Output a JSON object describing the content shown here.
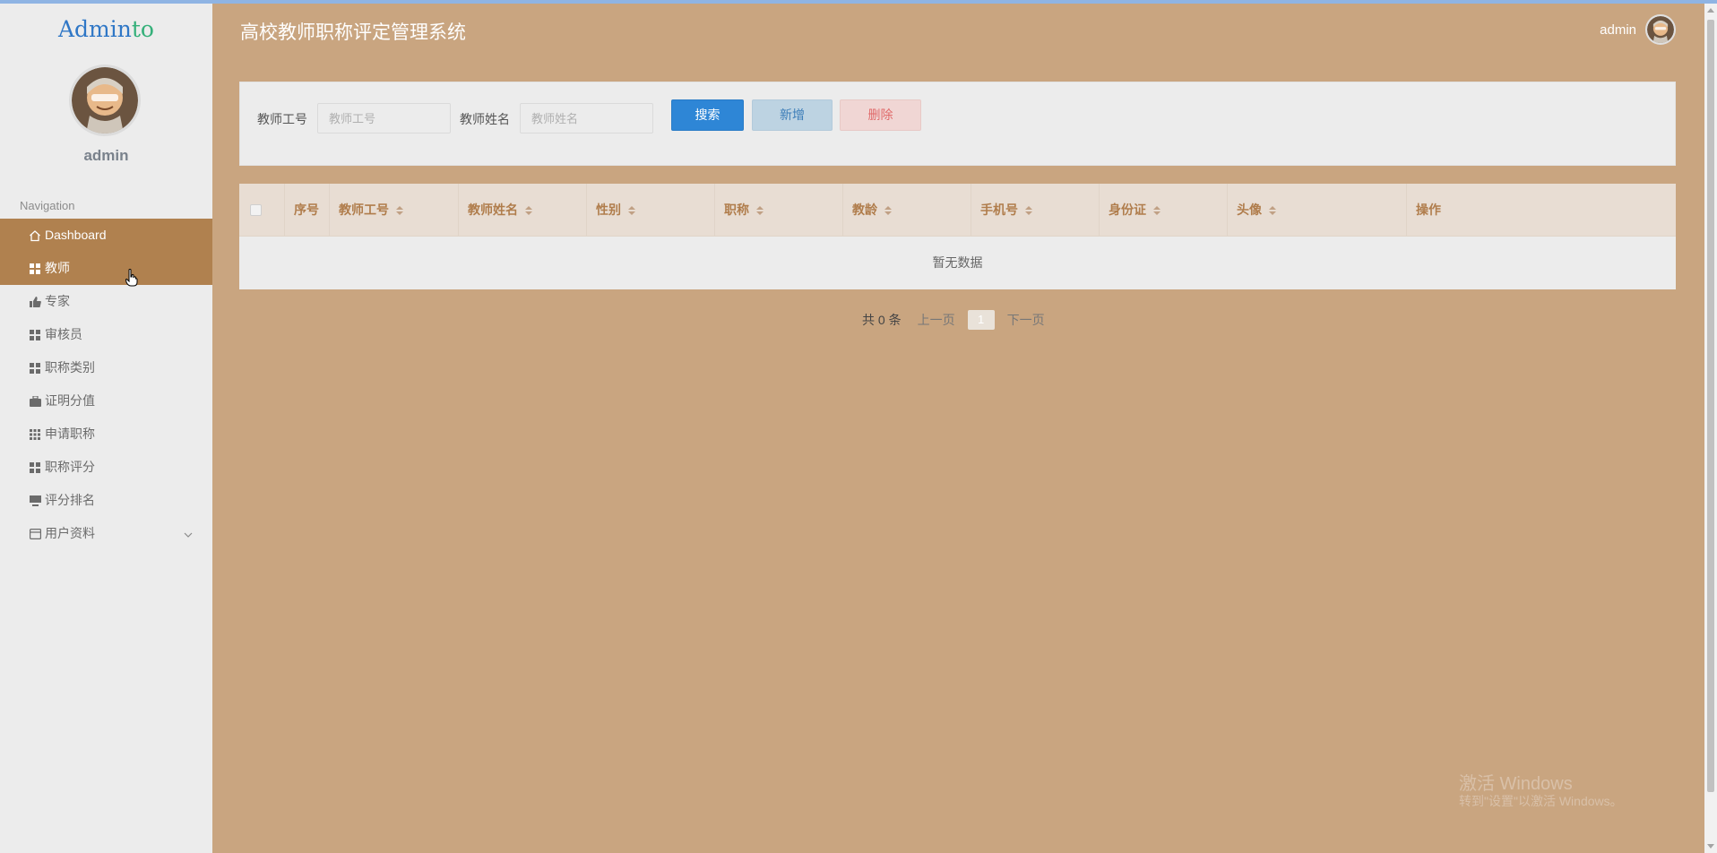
{
  "sidebar": {
    "logo_main": "Admin",
    "logo_accent": "to",
    "user_name": "admin",
    "nav_heading": "Navigation",
    "items": [
      {
        "label": "Dashboard",
        "icon": "home-icon",
        "active": true
      },
      {
        "label": "教师",
        "icon": "grid-icon",
        "active": true
      },
      {
        "label": "专家",
        "icon": "thumbs-up-icon"
      },
      {
        "label": "审核员",
        "icon": "grid-icon"
      },
      {
        "label": "职称类别",
        "icon": "grid-icon"
      },
      {
        "label": "证明分值",
        "icon": "briefcase-icon"
      },
      {
        "label": "申请职称",
        "icon": "apps-icon"
      },
      {
        "label": "职称评分",
        "icon": "grid-icon"
      },
      {
        "label": "评分排名",
        "icon": "monitor-icon"
      },
      {
        "label": "用户资料",
        "icon": "card-icon",
        "expandable": true
      }
    ]
  },
  "header": {
    "title": "高校教师职称评定管理系统",
    "user_name": "admin"
  },
  "search": {
    "teacher_no_label": "教师工号",
    "teacher_no_placeholder": "教师工号",
    "teacher_no_value": "",
    "teacher_name_label": "教师姓名",
    "teacher_name_placeholder": "教师姓名",
    "teacher_name_value": "",
    "search_button": "搜索",
    "add_button": "新增",
    "delete_button": "删除"
  },
  "table": {
    "columns": [
      "序号",
      "教师工号",
      "教师姓名",
      "性别",
      "职称",
      "教龄",
      "手机号",
      "身份证",
      "头像",
      "操作"
    ],
    "sortable": [
      false,
      true,
      true,
      true,
      true,
      true,
      true,
      true,
      true,
      false
    ],
    "empty_text": "暂无数据"
  },
  "pagination": {
    "total": "共 0 条",
    "prev": "上一页",
    "current_page": "1",
    "next": "下一页"
  },
  "watermark": {
    "line1": "激活 Windows",
    "line2": "转到\"设置\"以激活 Windows。"
  },
  "colors": {
    "background": "#c9a580",
    "sidebar": "#ececec",
    "active_nav": "#b0814f",
    "primary": "#2e86d6",
    "header_text": "#b07d4c"
  }
}
